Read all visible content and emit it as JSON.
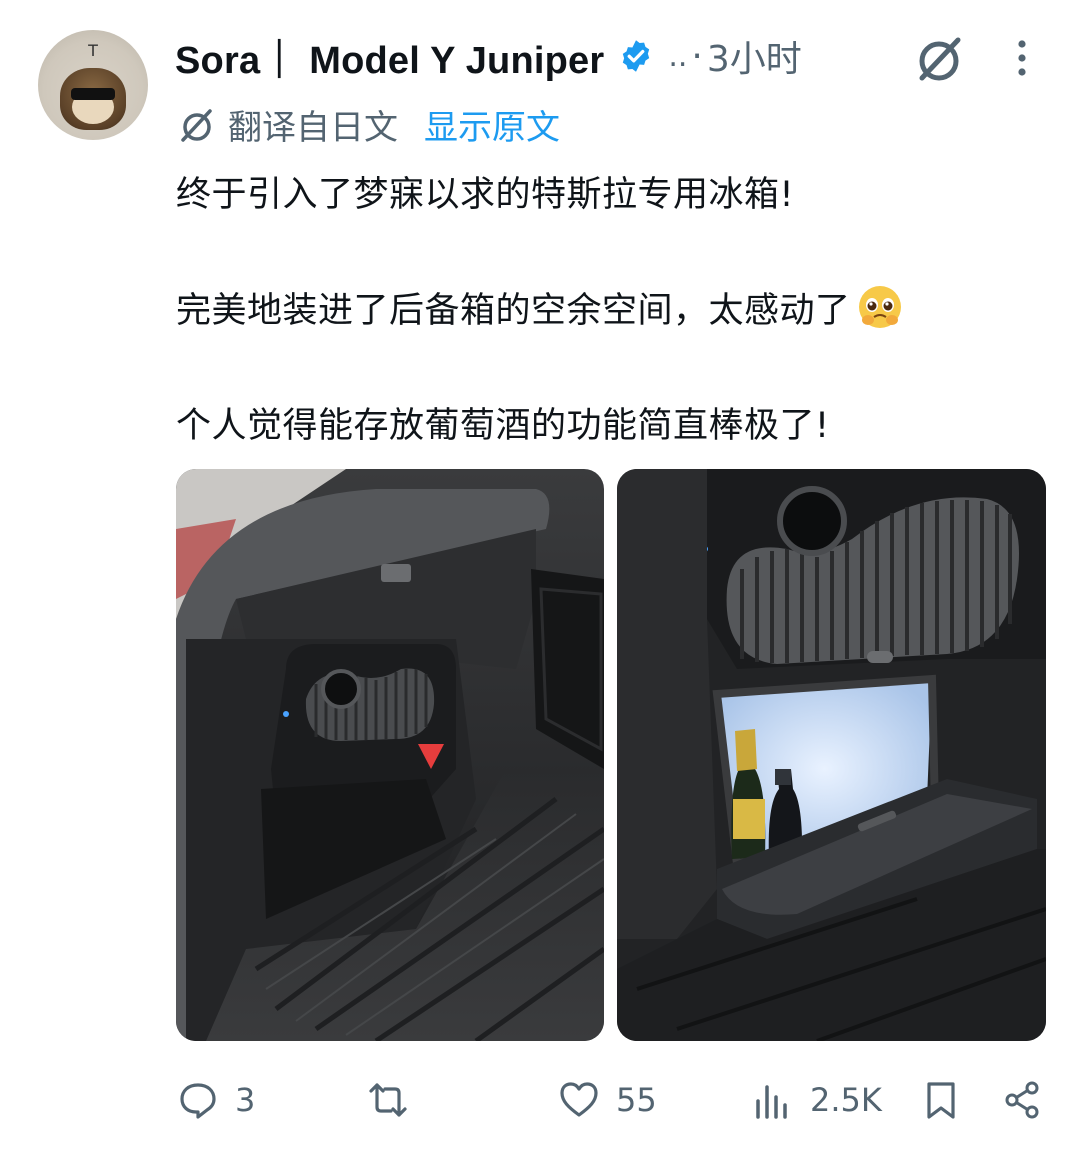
{
  "author": {
    "display_name": "Sora｜ Model Y Juniper",
    "more_indicator": "..",
    "separator": "·",
    "time": "3小时"
  },
  "translation": {
    "label": "翻译自日文",
    "show_original": "显示原文"
  },
  "tweet": {
    "line1": "终于引入了梦寐以求的特斯拉专用冰箱!",
    "line2": "完美地装进了后备箱的空余空间，太感动了",
    "line3": "个人觉得能存放葡萄酒的功能简直棒极了!"
  },
  "actions": {
    "replies": "3",
    "likes": "55",
    "views": "2.5K"
  },
  "colors": {
    "text": "#0f1419",
    "secondary": "#536471",
    "link": "#1d9bf0",
    "verified": "#1d9bf0"
  },
  "icons": {
    "verified": "verified-badge-icon",
    "grok": "grok-icon",
    "more": "more-vertical-icon",
    "translate": "translate-icon",
    "reply": "reply-icon",
    "retweet": "retweet-icon",
    "like": "heart-icon",
    "views": "views-icon",
    "bookmark": "bookmark-icon",
    "share": "share-icon",
    "emoji": "pleading-face-emoji"
  }
}
